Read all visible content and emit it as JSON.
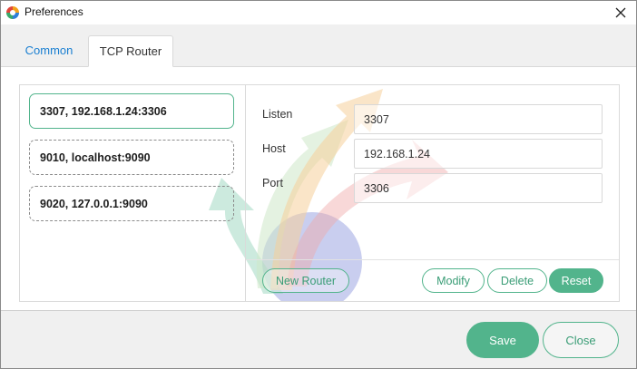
{
  "window": {
    "title": "Preferences"
  },
  "tabs": [
    {
      "label": "Common",
      "active": false
    },
    {
      "label": "TCP Router",
      "active": true
    }
  ],
  "routes": [
    {
      "label": "3307, 192.168.1.24:3306",
      "selected": true
    },
    {
      "label": "9010, localhost:9090",
      "selected": false
    },
    {
      "label": "9020, 127.0.0.1:9090",
      "selected": false
    }
  ],
  "form": {
    "listen": {
      "label": "Listen",
      "value": "3307"
    },
    "host": {
      "label": "Host",
      "value": "192.168.1.24"
    },
    "port": {
      "label": "Port",
      "value": "3306"
    }
  },
  "actions": {
    "new_router": "New Router",
    "modify": "Modify",
    "delete": "Delete",
    "reset": "Reset"
  },
  "footer": {
    "save": "Save",
    "close": "Close"
  },
  "colors": {
    "accent": "#52b48c",
    "tab_active": "#1a7fd1"
  },
  "icons": {
    "app": "app-logo-icon",
    "close": "close-icon",
    "watermark": "arrows-watermark-icon"
  }
}
